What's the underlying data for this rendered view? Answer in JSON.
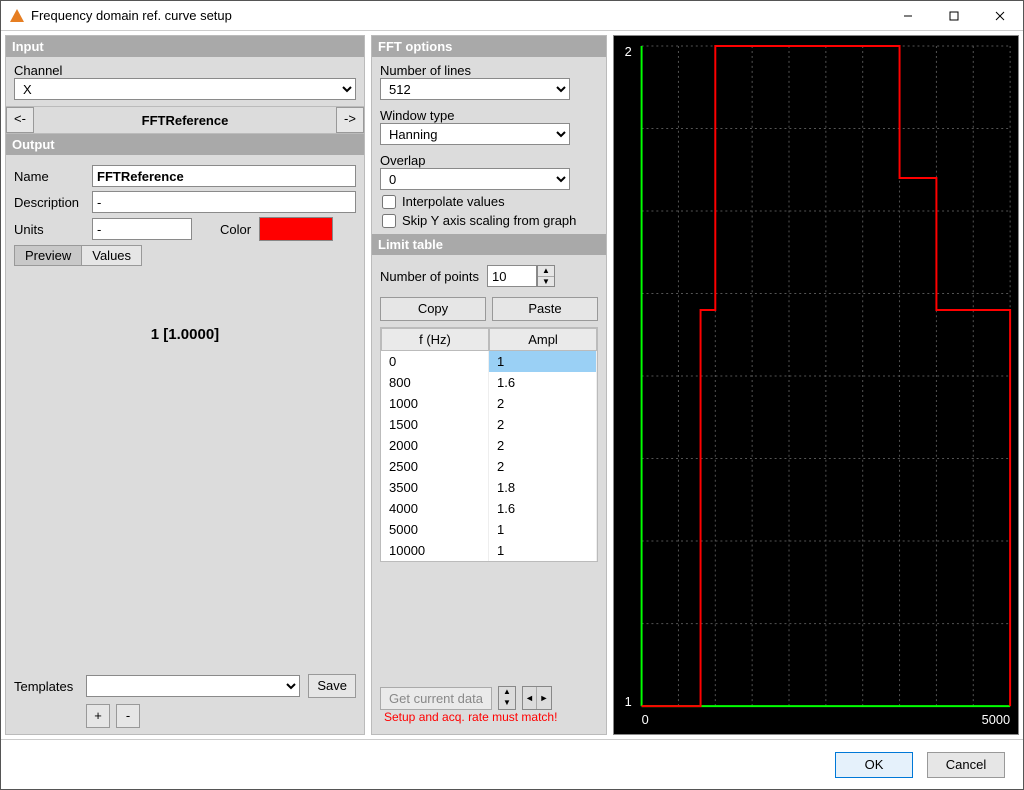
{
  "window": {
    "title": "Frequency domain ref. curve setup"
  },
  "input": {
    "header": "Input",
    "channel_label": "Channel",
    "channel_value": "X"
  },
  "nav": {
    "prev": "<-",
    "title": "FFTReference",
    "next": "->"
  },
  "output": {
    "header": "Output",
    "name_label": "Name",
    "name_value": "FFTReference",
    "desc_label": "Description",
    "desc_value": "-",
    "units_label": "Units",
    "units_value": "-",
    "color_label": "Color",
    "color_value": "#ff0000",
    "tabs": {
      "preview": "Preview",
      "values": "Values"
    },
    "midtext": "1 [1.0000]"
  },
  "templates": {
    "label": "Templates",
    "save": "Save",
    "add": "+",
    "remove": "-",
    "value": ""
  },
  "fft": {
    "header": "FFT options",
    "lines_label": "Number of lines",
    "lines_value": "512",
    "window_label": "Window type",
    "window_value": "Hanning",
    "overlap_label": "Overlap",
    "overlap_value": "0",
    "interp": "Interpolate values",
    "skipy": "Skip Y axis scaling from graph"
  },
  "limit": {
    "header": "Limit table",
    "points_label": "Number of points",
    "points_value": "10",
    "copy": "Copy",
    "paste": "Paste",
    "cols": {
      "f": "f (Hz)",
      "a": "Ampl"
    },
    "rows": [
      {
        "f": "0",
        "a": "1"
      },
      {
        "f": "800",
        "a": "1.6"
      },
      {
        "f": "1000",
        "a": "2"
      },
      {
        "f": "1500",
        "a": "2"
      },
      {
        "f": "2000",
        "a": "2"
      },
      {
        "f": "2500",
        "a": "2"
      },
      {
        "f": "3500",
        "a": "1.8"
      },
      {
        "f": "4000",
        "a": "1.6"
      },
      {
        "f": "5000",
        "a": "1"
      },
      {
        "f": "10000",
        "a": "1"
      }
    ],
    "getdata": "Get current data",
    "warn": "Setup and acq. rate must match!"
  },
  "chart_data": {
    "type": "line",
    "x": [
      0,
      800,
      1000,
      1500,
      2000,
      2500,
      3500,
      4000,
      5000,
      10000
    ],
    "y": [
      1,
      1.6,
      2,
      2,
      2,
      2,
      1.8,
      1.6,
      1,
      1
    ],
    "xlim": [
      0,
      5000
    ],
    "ylim": [
      1,
      2
    ],
    "xticks": [
      "0",
      "5000"
    ],
    "yticks": [
      "1",
      "2"
    ],
    "step": true,
    "line_color": "#ff0000",
    "axis_color": "#00ff00",
    "grid_color": "#555555"
  },
  "footer": {
    "ok": "OK",
    "cancel": "Cancel"
  }
}
